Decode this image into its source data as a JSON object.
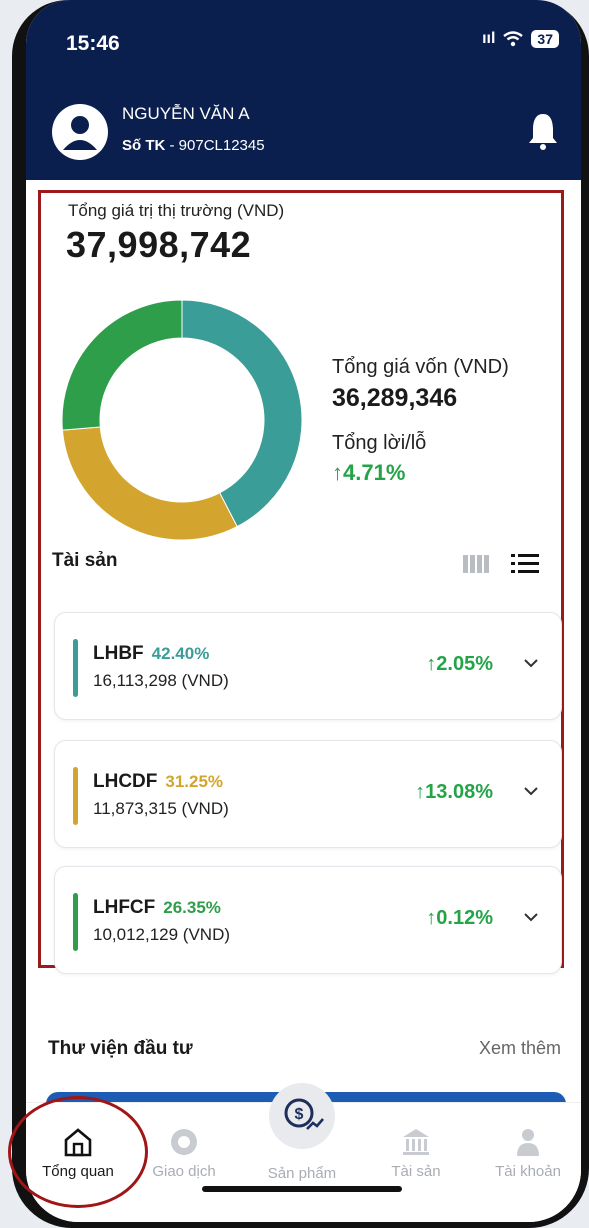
{
  "status_bar": {
    "time": "15:46",
    "signal": "ııl",
    "battery": "37"
  },
  "header": {
    "user_name": "NGUYỄN VĂN A",
    "account_label": "Số TK",
    "account_number": " - 907CL12345"
  },
  "summary": {
    "market_value_label": "Tổng giá trị thị trường (VND)",
    "market_value": "37,998,742",
    "cost_label": "Tổng giá vốn (VND)",
    "cost_value": "36,289,346",
    "pl_label": "Tổng lời/lỗ",
    "pl_value": "↑4.71%"
  },
  "chart_data": {
    "type": "pie",
    "categories": [
      "LHBF",
      "LHCDF",
      "LHFCF"
    ],
    "values": [
      42.4,
      31.25,
      26.35
    ],
    "colors": [
      "#3a9d97",
      "#d3a52f",
      "#2e9e4a"
    ]
  },
  "assets": {
    "title": "Tài sản",
    "funds": [
      {
        "code": "LHBF",
        "percent": "42.40%",
        "value": "16,113,298 (VND)",
        "change": "↑2.05%",
        "color": "#3a9d97"
      },
      {
        "code": "LHCDF",
        "percent": "31.25%",
        "value": "11,873,315 (VND)",
        "change": "↑13.08%",
        "color": "#d3a52f"
      },
      {
        "code": "LHFCF",
        "percent": "26.35%",
        "value": "10,012,129 (VND)",
        "change": "↑0.12%",
        "color": "#2e9e4a"
      }
    ]
  },
  "library": {
    "title": "Thư viện đầu tư",
    "more": "Xem thêm"
  },
  "tabs": [
    {
      "label": "Tổng quan",
      "icon": "home-icon",
      "active": true
    },
    {
      "label": "Giao dịch",
      "icon": "coin-icon",
      "active": false
    },
    {
      "label": "Sản phẩm",
      "icon": "dollar-growth-icon",
      "active": false
    },
    {
      "label": "Tài sản",
      "icon": "bank-icon",
      "active": false
    },
    {
      "label": "Tài khoản",
      "icon": "person-icon",
      "active": false
    }
  ]
}
